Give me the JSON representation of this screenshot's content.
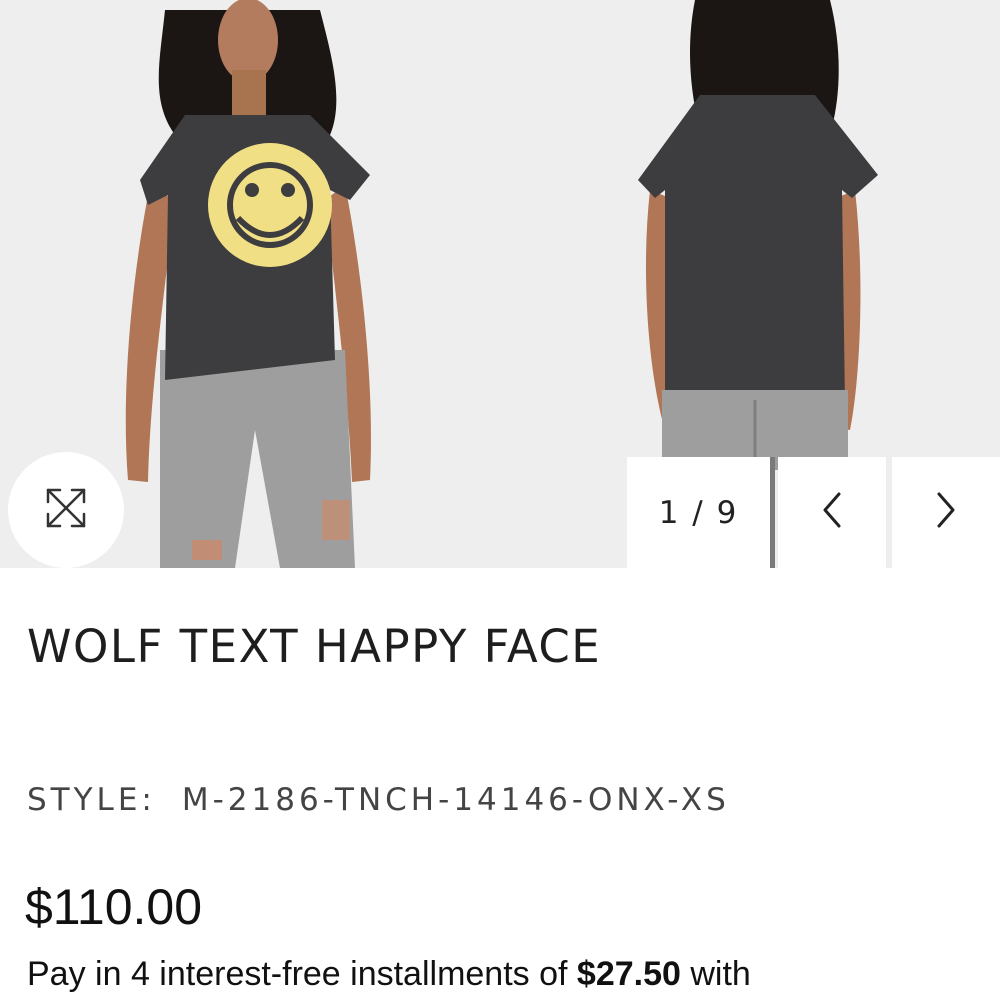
{
  "gallery": {
    "counter": "1 / 9",
    "current_index": 1,
    "total_images": 9,
    "icons": {
      "expand": "expand-arrows-icon",
      "prev": "chevron-left-icon",
      "next": "chevron-right-icon"
    }
  },
  "product": {
    "title": "WOLF TEXT HAPPY FACE",
    "style_label": "STYLE:",
    "style_value": "M-2186-TNCH-14146-ONX-XS",
    "price": "$110.00",
    "installments": {
      "prefix": "Pay in 4 interest-free installments of ",
      "amount": "$27.50",
      "suffix": " with"
    }
  },
  "colors": {
    "gallery_background": "#eeeeee",
    "shirt": "#3d3d3f",
    "graphic": "#f1df86",
    "jeans": "#9e9e9e"
  }
}
